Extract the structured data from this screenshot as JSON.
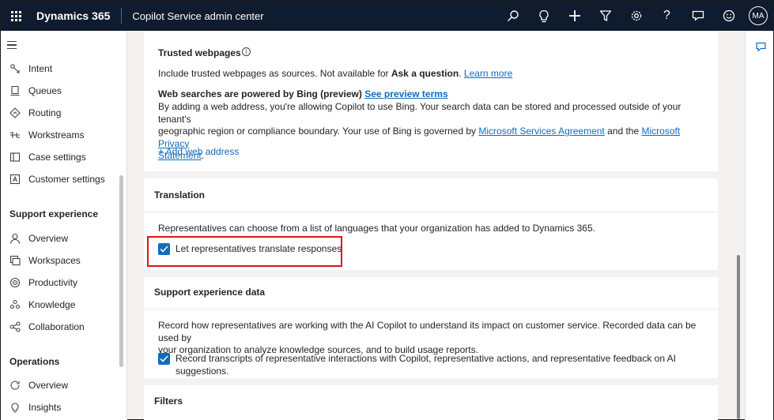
{
  "topbar": {
    "brand": "Dynamics 365",
    "app_name": "Copilot Service admin center",
    "icons": [
      "search-icon",
      "lightbulb-icon",
      "add-icon",
      "filter-icon",
      "settings-icon",
      "help-icon",
      "chat-icon",
      "smiley-icon"
    ],
    "avatar_initials": "MA"
  },
  "sidebar": {
    "items_top": [
      {
        "label": "Intent",
        "icon": "intent-icon"
      },
      {
        "label": "Queues",
        "icon": "queues-icon"
      },
      {
        "label": "Routing",
        "icon": "routing-icon"
      },
      {
        "label": "Workstreams",
        "icon": "workstreams-icon"
      },
      {
        "label": "Case settings",
        "icon": "case-settings-icon"
      },
      {
        "label": "Customer settings",
        "icon": "customer-settings-icon"
      }
    ],
    "section_support": "Support experience",
    "items_support": [
      {
        "label": "Overview",
        "icon": "person-icon"
      },
      {
        "label": "Workspaces",
        "icon": "workspaces-icon"
      },
      {
        "label": "Productivity",
        "icon": "productivity-icon"
      },
      {
        "label": "Knowledge",
        "icon": "knowledge-icon"
      },
      {
        "label": "Collaboration",
        "icon": "collaboration-icon"
      }
    ],
    "section_operations": "Operations",
    "items_operations": [
      {
        "label": "Overview",
        "icon": "overview-icon"
      },
      {
        "label": "Insights",
        "icon": "insights-icon"
      }
    ]
  },
  "trusted": {
    "title": "Trusted webpages",
    "desc_prefix": "Include trusted webpages as sources. Not available for ",
    "desc_bold": "Ask a question",
    "desc_suffix": ".",
    "learn_more": "Learn more",
    "bing_title": "Web searches are powered by Bing (preview)",
    "preview_link": "See preview terms",
    "bing_line1": "By adding a web address, you're allowing Copilot to use Bing. Your search data can be stored and processed outside of your tenant's",
    "bing_line2_prefix": "geographic region or compliance boundary. Your use of Bing is governed by ",
    "msa_link": "Microsoft Services Agreement",
    "and_text": " and the ",
    "privacy_link_1": "Microsoft Privacy",
    "privacy_link_2": "Statement",
    "add_web": "+ Add web address"
  },
  "translation": {
    "title": "Translation",
    "desc": "Representatives can choose from a list of languages that your organization has added to Dynamics 365.",
    "checkbox_label": "Let representatives translate responses",
    "checked": true
  },
  "support_data": {
    "title": "Support experience data",
    "desc_line1": "Record how representatives are working with the AI Copilot to understand its impact on customer service. Recorded data can be used by",
    "desc_line2": "your organization to analyze knowledge sources, and to build usage reports.",
    "checkbox_label": "Record transcripts of representative interactions with Copilot, representative actions, and representative feedback on AI suggestions.",
    "checked": true
  },
  "filters": {
    "title": "Filters"
  },
  "colors": {
    "topbar": "#0f1b2e",
    "accent": "#0f6cbd",
    "highlight": "#e0121b"
  }
}
